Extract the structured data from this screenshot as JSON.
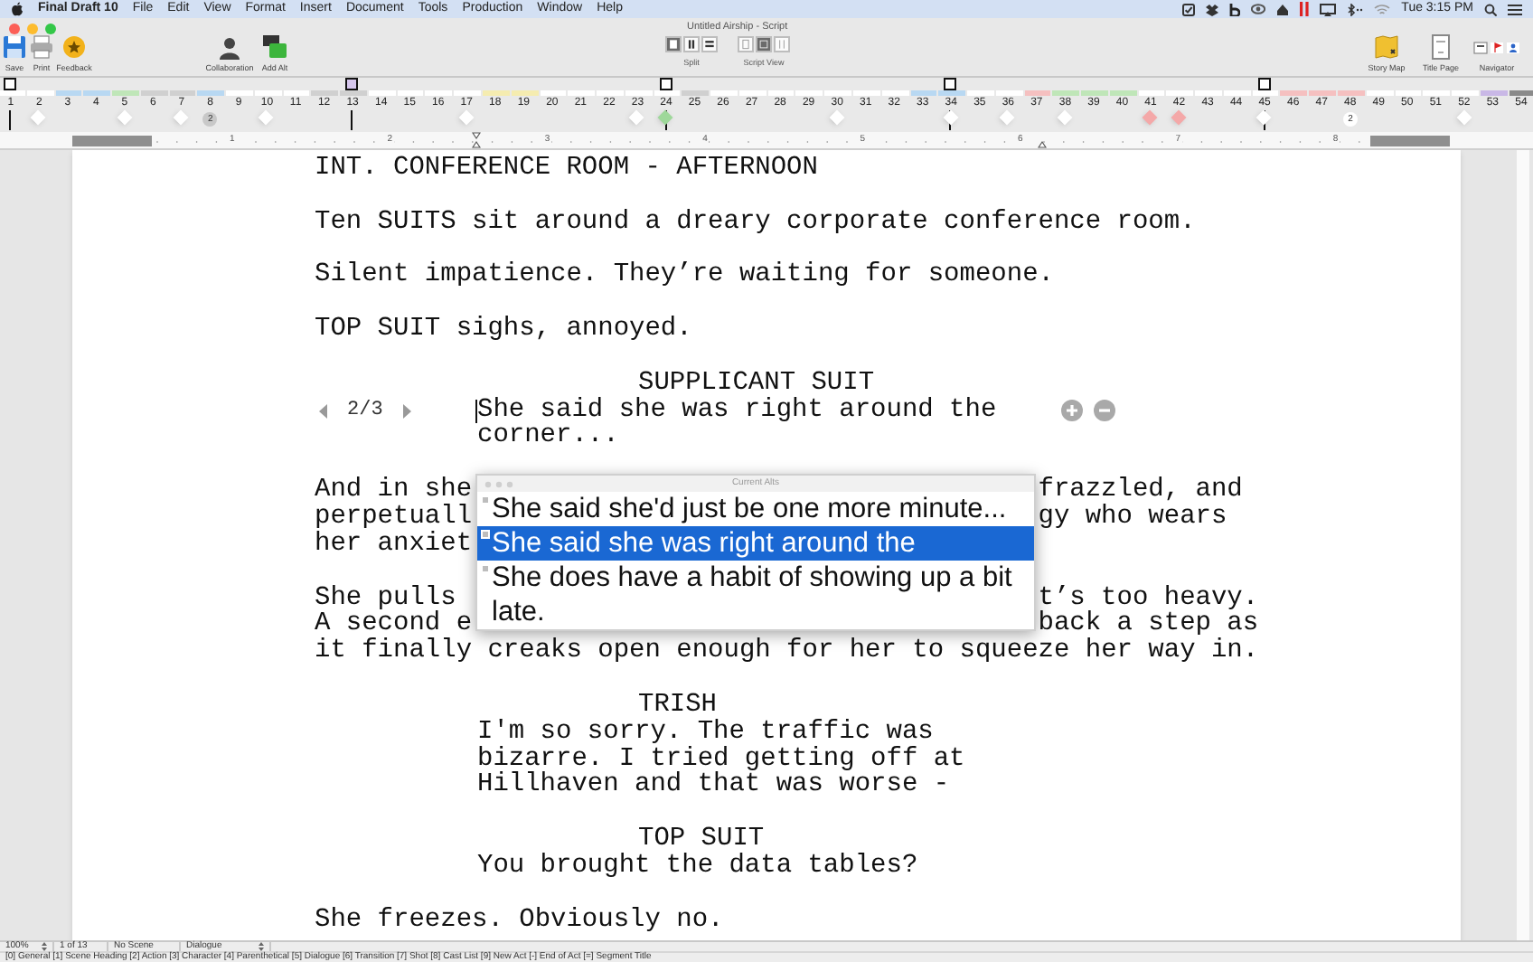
{
  "menubar": {
    "app": "Final Draft 10",
    "menus": [
      "File",
      "Edit",
      "View",
      "Format",
      "Insert",
      "Document",
      "Tools",
      "Production",
      "Window",
      "Help"
    ],
    "clock": "Tue 3:15 PM"
  },
  "window": {
    "title": "Untitled Airship - Script"
  },
  "toolbar": {
    "left": [
      {
        "kind": "save",
        "label": "Save"
      },
      {
        "kind": "print",
        "label": "Print"
      },
      {
        "kind": "feedback",
        "label": "Feedback"
      },
      {
        "kind": "collaboration",
        "label": "Collaboration"
      },
      {
        "kind": "add_alt",
        "label": "Add Alt"
      }
    ],
    "split": {
      "label": "Split",
      "buttons": [
        {
          "kind": "single",
          "selected": true
        },
        {
          "kind": "columns",
          "selected": false
        },
        {
          "kind": "rows",
          "selected": false
        }
      ]
    },
    "script_view": {
      "label": "Script View",
      "buttons": [
        {
          "kind": "page",
          "selected": false
        },
        {
          "kind": "speed",
          "selected": true
        },
        {
          "kind": "index",
          "selected": false
        }
      ]
    },
    "right": [
      {
        "kind": "story_map",
        "label": "Story Map"
      },
      {
        "kind": "title_page",
        "label": "Title Page"
      },
      {
        "kind": "navigator",
        "label": "Navigator"
      }
    ]
  },
  "scenes": [
    {
      "label": "1",
      "page_break": {
        "color": "#ffffff"
      }
    },
    {
      "label": "2",
      "marker": {
        "color": "#ffffff"
      }
    },
    {
      "label": "3",
      "color": "#b8d8f2"
    },
    {
      "label": "4",
      "color": "#b8d8f2"
    },
    {
      "label": "5",
      "color": "#bfe6b8",
      "marker": {
        "color": "#ffffff"
      }
    },
    {
      "label": "6",
      "color": "#d0d0d0"
    },
    {
      "label": "7",
      "color": "#d0d0d0",
      "marker": {
        "color": "#ffffff"
      }
    },
    {
      "label": "8",
      "color": "#b8d8f2",
      "marker": {
        "color": "#c8c8c8",
        "count": "2"
      }
    },
    {
      "label": "9"
    },
    {
      "label": "10",
      "marker": {
        "color": "#ffffff"
      }
    },
    {
      "label": "11"
    },
    {
      "label": "12",
      "color": "#d0d0d0"
    },
    {
      "label": "13",
      "color": "#d0d0d0",
      "page_break": {
        "color": "#d7c7ee"
      }
    },
    {
      "label": "14"
    },
    {
      "label": "15"
    },
    {
      "label": "16"
    },
    {
      "label": "17",
      "marker": {
        "color": "#ffffff"
      }
    },
    {
      "label": "18",
      "color": "#f5ecb0"
    },
    {
      "label": "19",
      "color": "#f5ecb0"
    },
    {
      "label": "20"
    },
    {
      "label": "21"
    },
    {
      "label": "22"
    },
    {
      "label": "23",
      "marker": {
        "color": "#ffffff"
      }
    },
    {
      "label": "24",
      "page_break": {
        "color": "#ffffff"
      },
      "marker": {
        "color": "#9ed89a"
      }
    },
    {
      "label": "25",
      "color": "#d0d0d0"
    },
    {
      "label": "26"
    },
    {
      "label": "27"
    },
    {
      "label": "28"
    },
    {
      "label": "29"
    },
    {
      "label": "30",
      "marker": {
        "color": "#ffffff"
      }
    },
    {
      "label": "31"
    },
    {
      "label": "32"
    },
    {
      "label": "33",
      "color": "#b8d8f2"
    },
    {
      "label": "34",
      "color": "#b8d8f2",
      "page_break": {
        "color": "#ffffff"
      },
      "marker": {
        "color": "#ffffff"
      }
    },
    {
      "label": "35"
    },
    {
      "label": "36",
      "marker": {
        "color": "#ffffff"
      }
    },
    {
      "label": "37",
      "color": "#f5c0c0"
    },
    {
      "label": "38",
      "color": "#bfe6b8",
      "marker": {
        "color": "#ffffff"
      }
    },
    {
      "label": "39",
      "color": "#bfe6b8"
    },
    {
      "label": "40",
      "color": "#bfe6b8"
    },
    {
      "label": "41",
      "marker": {
        "color": "#f4a8a8"
      }
    },
    {
      "label": "42",
      "marker": {
        "color": "#f4a8a8"
      }
    },
    {
      "label": "43"
    },
    {
      "label": "44"
    },
    {
      "label": "45",
      "page_break": {
        "color": "#ffffff"
      },
      "marker": {
        "color": "#ffffff"
      }
    },
    {
      "label": "46",
      "color": "#f5c0c0"
    },
    {
      "label": "47",
      "color": "#f5c0c0"
    },
    {
      "label": "48",
      "color": "#f5c0c0",
      "marker": {
        "color": "#ffffff",
        "count": "2"
      }
    },
    {
      "label": "49"
    },
    {
      "label": "50"
    },
    {
      "label": "51"
    },
    {
      "label": "52",
      "marker": {
        "color": "#ffffff"
      }
    },
    {
      "label": "53",
      "color": "#c9b8e6"
    },
    {
      "label": "54",
      "color": "#8a8a8a"
    }
  ],
  "ruler": {
    "numbers": [
      "1",
      "2",
      "3",
      "4",
      "5",
      "6",
      "7",
      "8"
    ]
  },
  "script": [
    {
      "kind": "scene_heading",
      "text": "INT. CONFERENCE ROOM - AFTERNOON"
    },
    {
      "kind": "action",
      "text": "Ten SUITS sit around a dreary corporate conference room."
    },
    {
      "kind": "action",
      "text": "Silent impatience. They’re waiting for someone."
    },
    {
      "kind": "action",
      "text": "TOP SUIT sighs, annoyed."
    },
    {
      "kind": "character",
      "text": "SUPPLICANT SUIT"
    },
    {
      "kind": "dialogue",
      "text": "She said she was right around the corner...",
      "caret": true,
      "alternates": "2/3"
    },
    {
      "kind": "covered",
      "lines": [
        {
          "left": "And in she",
          "right": "frazzled, and"
        },
        {
          "left": "perpetuall",
          "right": "gy who wears"
        },
        {
          "left": "her anxiet"
        }
      ]
    },
    {
      "kind": "covered",
      "lines": [
        {
          "left": "She pulls",
          "right": "t’s too heavy."
        },
        {
          "left": "A second e",
          "right": "back a step as"
        },
        {
          "left": "it finally creaks open enough for her to squeeze her way in."
        }
      ]
    },
    {
      "kind": "character",
      "text": "TRISH"
    },
    {
      "kind": "dialogue",
      "text": "I'm so sorry. The traffic was bizarre. I tried getting off at Hillhaven and that was worse -"
    },
    {
      "kind": "character",
      "text": "TOP SUIT"
    },
    {
      "kind": "dialogue",
      "text": "You brought the data tables?"
    },
    {
      "kind": "action",
      "text": "She freezes. Obviously no."
    }
  ],
  "alts_popup": {
    "title": "Current Alts",
    "items": [
      {
        "text": "She said she'd just be one more minute...",
        "selected": false
      },
      {
        "text": "She said she was right around the",
        "selected": true
      },
      {
        "text": "She does have a habit of showing up a bit late.",
        "selected": false
      }
    ]
  },
  "status_bar": {
    "zoom": "100%",
    "page": "1 of 13",
    "scene": "No Scene",
    "element": "Dialogue",
    "shortcuts": "[0] General [1] Scene Heading [2] Action [3] Character [4] Parenthetical [5] Dialogue [6] Transition [7] Shot [8] Cast List [9] New Act [-] End of Act [=] Segment Title"
  }
}
